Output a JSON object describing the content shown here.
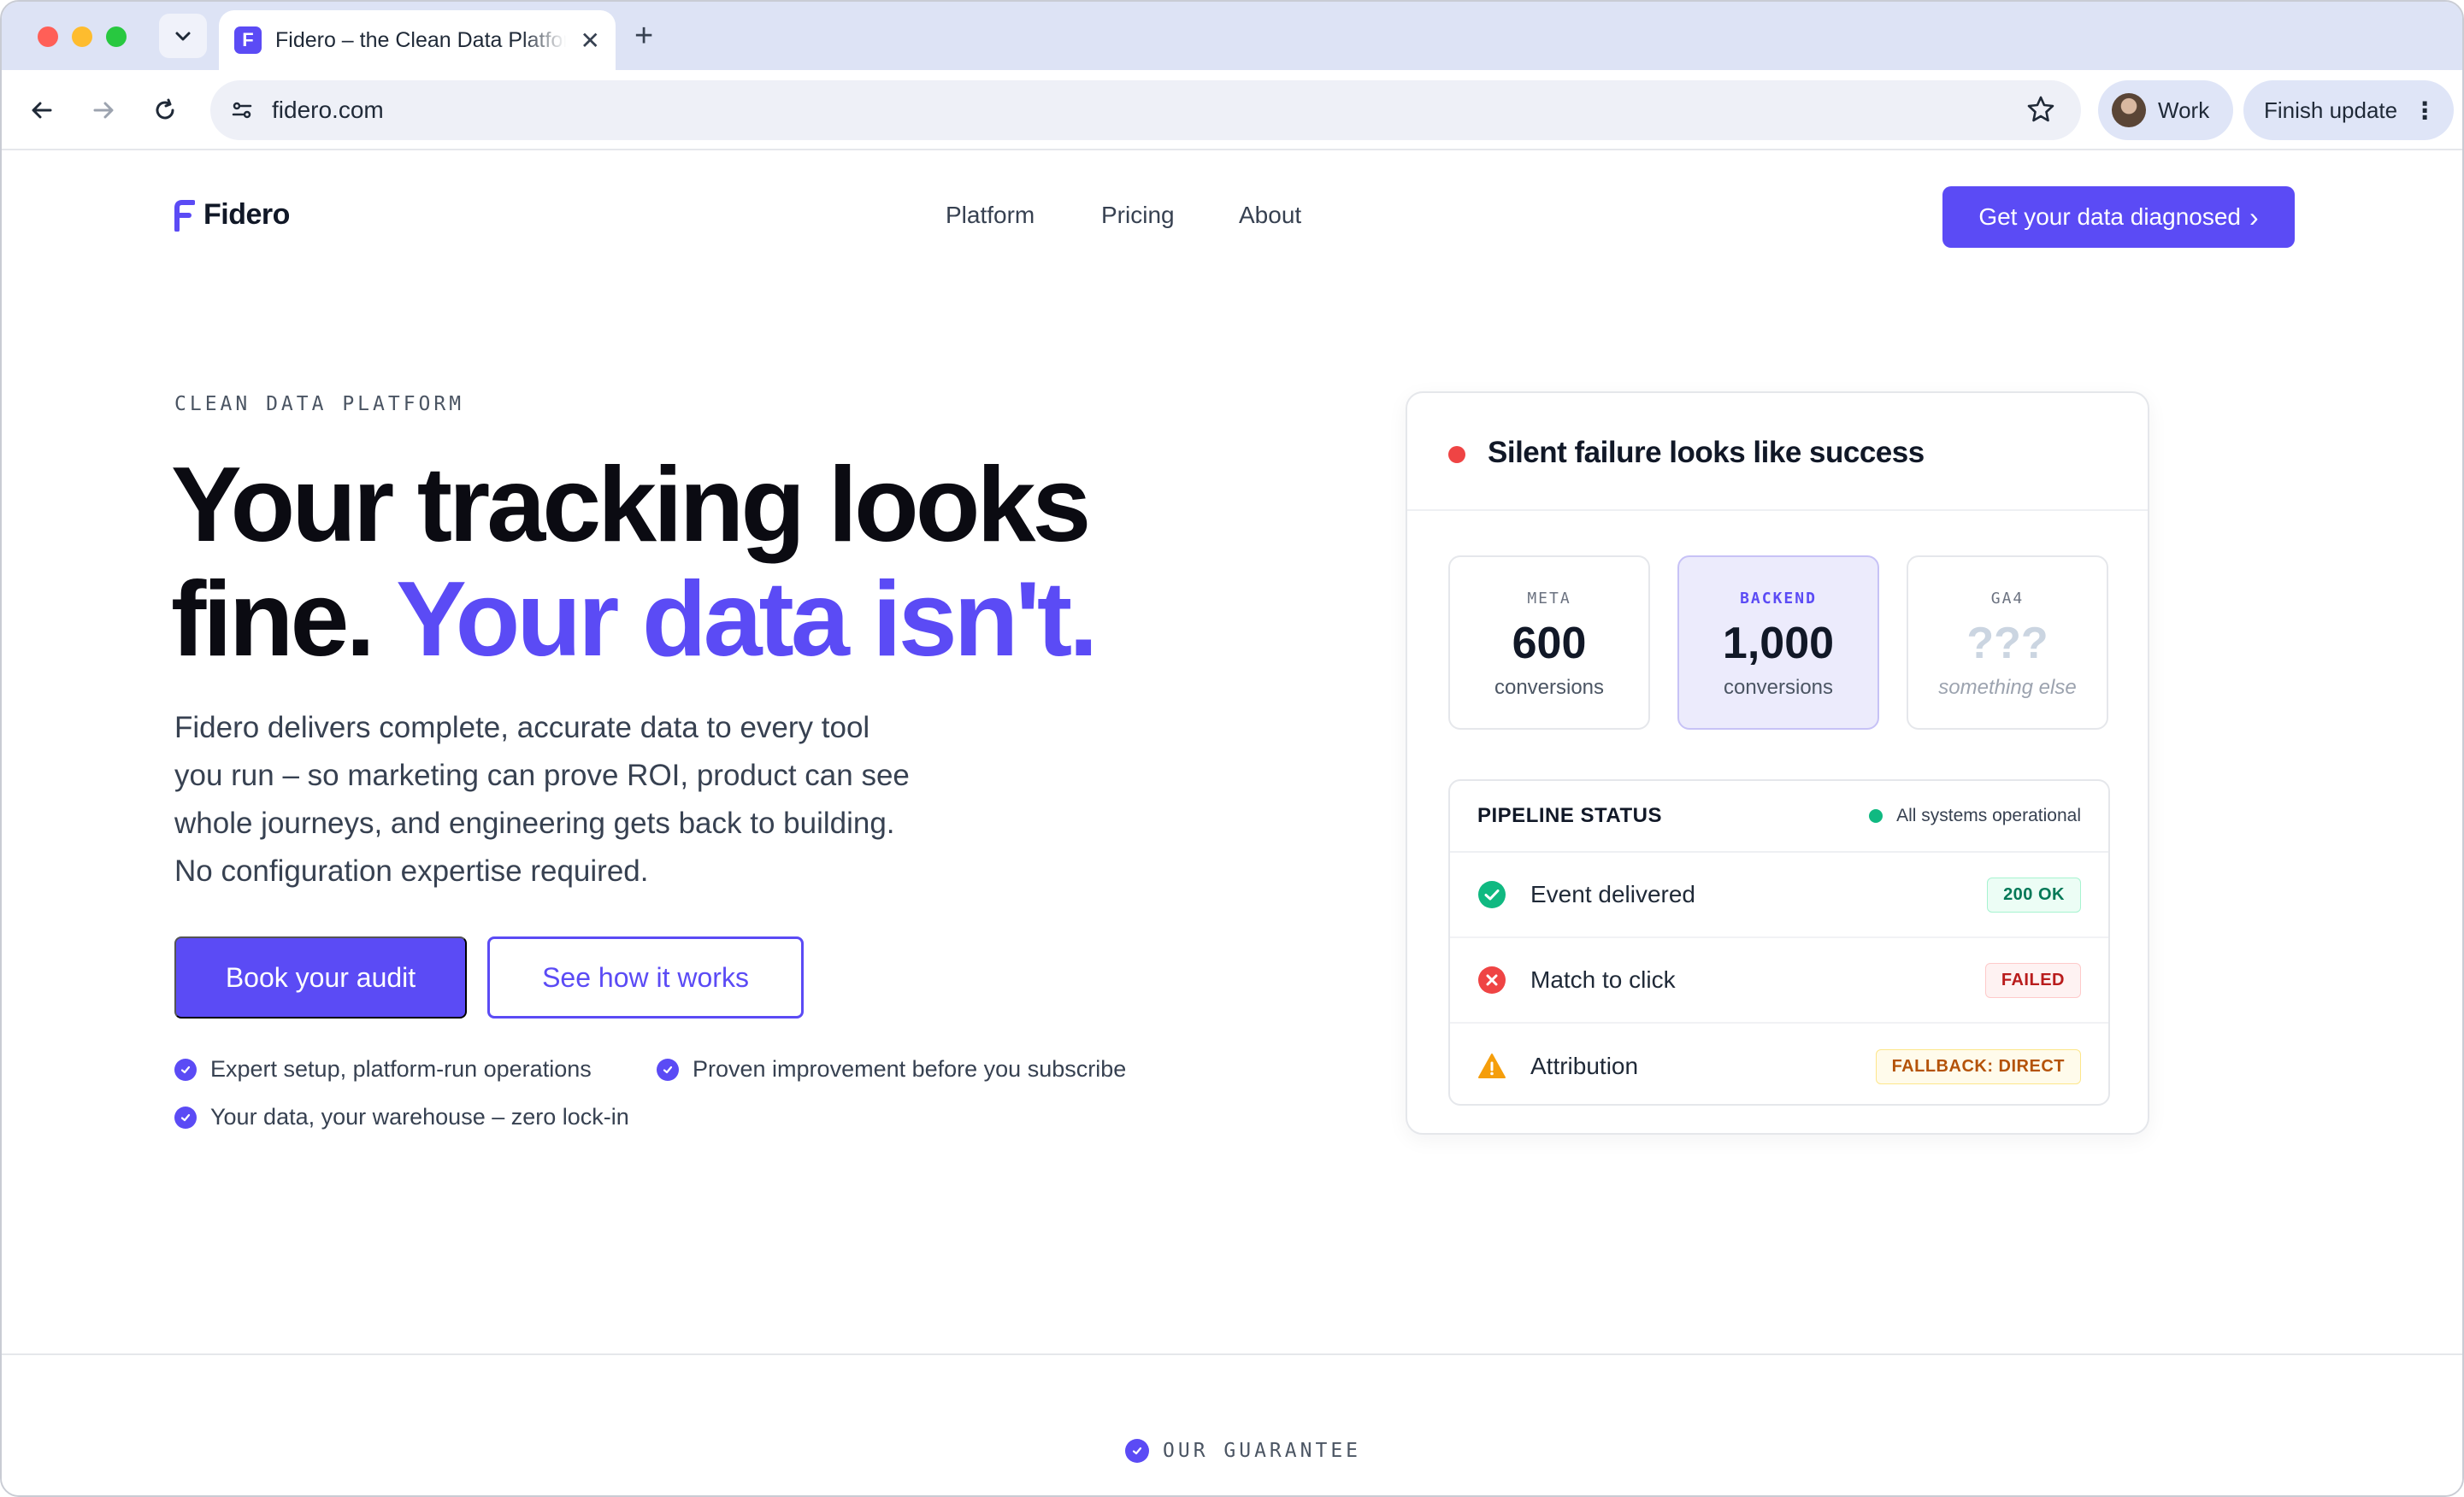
{
  "browser": {
    "tab_title": "Fidero – the Clean Data Platform",
    "tab_favicon_letter": "F",
    "url": "fidero.com",
    "profile_label": "Work",
    "update_label": "Finish update",
    "new_tab_symbol": "+",
    "close_symbol": "✕",
    "kebab_symbol": "⋮"
  },
  "site": {
    "brand": "Fidero",
    "nav": [
      "Platform",
      "Pricing",
      "About"
    ],
    "cta_top": "Get your data diagnosed",
    "cta_chevron": "›"
  },
  "hero": {
    "eyebrow": "CLEAN DATA PLATFORM",
    "headline_line1": "Your tracking looks",
    "headline_line2_plain": "fine.",
    "headline_line2_accent": "Your data isn't.",
    "lede": "Fidero delivers complete, accurate data to every tool you run – so marketing can prove ROI, product can see whole journeys, and engineering gets back to building. No configuration expertise required.",
    "primary_button": "Book your audit",
    "secondary_button": "See how it works",
    "bullets": [
      "Expert setup, platform-run operations",
      "Proven improvement before you subscribe",
      "Your data, your warehouse – zero lock-in"
    ]
  },
  "card": {
    "title": "Silent failure looks like success",
    "stats": [
      {
        "label": "META",
        "value": "600",
        "sub": "conversions"
      },
      {
        "label": "BACKEND",
        "value": "1,000",
        "sub": "conversions"
      },
      {
        "label": "GA4",
        "value": "???",
        "sub": "something else"
      }
    ],
    "pipeline": {
      "title": "PIPELINE STATUS",
      "status": "All systems operational",
      "rows": [
        {
          "label": "Event delivered",
          "badge": "200 OK"
        },
        {
          "label": "Match to click",
          "badge": "FAILED"
        },
        {
          "label": "Attribution",
          "badge": "FALLBACK: DIRECT"
        }
      ]
    }
  },
  "footer_teaser": {
    "label": "OUR GUARANTEE"
  },
  "colors": {
    "brand": "#5b4bf5",
    "success": "#10b981",
    "danger": "#ef4444",
    "warning": "#f59e0b"
  }
}
